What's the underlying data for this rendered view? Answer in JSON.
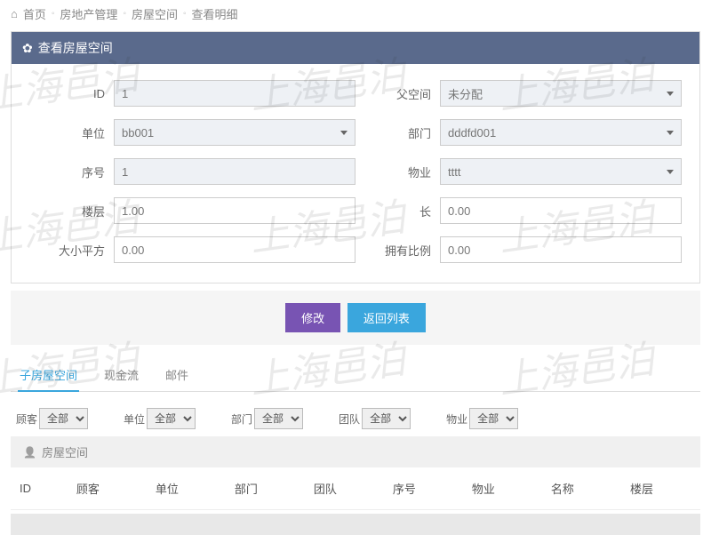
{
  "breadcrumb": {
    "home": "首页",
    "a": "房地产管理",
    "b": "房屋空间",
    "c": "查看明细"
  },
  "panel": {
    "title": "查看房屋空间"
  },
  "form": {
    "id_label": "ID",
    "id_value": "1",
    "parent_label": "父空间",
    "parent_value": "未分配",
    "unit_label": "单位",
    "unit_value": "bb001",
    "dept_label": "部门",
    "dept_value": "dddfd001",
    "seq_label": "序号",
    "seq_value": "1",
    "prop_label": "物业",
    "prop_value": "tttt",
    "floor_label": "楼层",
    "floor_value": "1.00",
    "length_label": "长",
    "length_value": "0.00",
    "size_label": "大小平方",
    "size_value": "0.00",
    "ratio_label": "拥有比例",
    "ratio_value": "0.00"
  },
  "buttons": {
    "edit": "修改",
    "back": "返回列表"
  },
  "tabs": {
    "t1": "子房屋空间",
    "t2": "现金流",
    "t3": "邮件"
  },
  "filters": {
    "customer_label": "顾客",
    "customer_value": "全部",
    "unit_label": "单位",
    "unit_value": "全部",
    "dept_label": "部门",
    "dept_value": "全部",
    "team_label": "团队",
    "team_value": "全部",
    "prop_label": "物业",
    "prop_value": "全部"
  },
  "section": {
    "title": "房屋空间"
  },
  "columns": {
    "c0": "ID",
    "c1": "顾客",
    "c2": "单位",
    "c3": "部门",
    "c4": "团队",
    "c5": "序号",
    "c6": "物业",
    "c7": "名称",
    "c8": "楼层"
  },
  "watermark": "上海邑泊"
}
